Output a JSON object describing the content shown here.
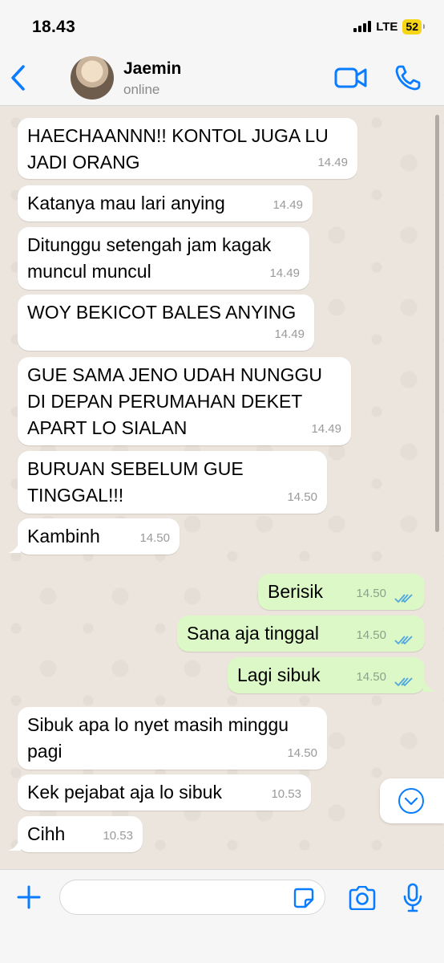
{
  "status_bar": {
    "time": "18.43",
    "network": "LTE",
    "battery": "52"
  },
  "header": {
    "contact_name": "Jaemin",
    "contact_status": "online",
    "icons": [
      "chevron-left-icon",
      "avatar",
      "video-icon",
      "phone-icon"
    ]
  },
  "messages": [
    {
      "dir": "in",
      "text": "HAECHAANNN!! KONTOL JUGA LU\nJADI ORANG",
      "time": "14.49"
    },
    {
      "dir": "in",
      "text": "Katanya mau lari anying",
      "time": "14.49"
    },
    {
      "dir": "in",
      "text": "Ditunggu setengah jam kagak\nmuncul muncul",
      "time": "14.49"
    },
    {
      "dir": "in",
      "text": "WOY BEKICOT BALES ANYING",
      "time": "14.49"
    },
    {
      "dir": "in",
      "text": "GUE SAMA JENO UDAH NUNGGU\nDI DEPAN PERUMAHAN DEKET\nAPART LO SIALAN",
      "time": "14.49"
    },
    {
      "dir": "in",
      "text": "BURUAN SEBELUM GUE\nTINGGAL!!!",
      "time": "14.50"
    },
    {
      "dir": "in",
      "text": "Kambinh",
      "time": "14.50"
    },
    {
      "dir": "out",
      "text": "Berisik",
      "time": "14.50",
      "read": true
    },
    {
      "dir": "out",
      "text": "Sana aja tinggal",
      "time": "14.50",
      "read": true
    },
    {
      "dir": "out",
      "text": "Lagi sibuk",
      "time": "14.50",
      "read": true
    },
    {
      "dir": "in",
      "text": "Sibuk apa lo nyet masih minggu\npagi",
      "time": "14.50"
    },
    {
      "dir": "in",
      "text": "Kek pejabat aja lo sibuk",
      "time": "10.53"
    },
    {
      "dir": "in",
      "text": "Cihh",
      "time": "10.53"
    }
  ],
  "input_bar": {
    "placeholder": "",
    "icons": [
      "plus-icon",
      "sticker-icon",
      "camera-icon",
      "microphone-icon"
    ]
  },
  "colors": {
    "accent": "#0a7cff",
    "incoming_bubble": "#ffffff",
    "outgoing_bubble": "#dcf8c6",
    "read_ticks": "#4fa6e0",
    "chat_background": "#ece5dd"
  }
}
